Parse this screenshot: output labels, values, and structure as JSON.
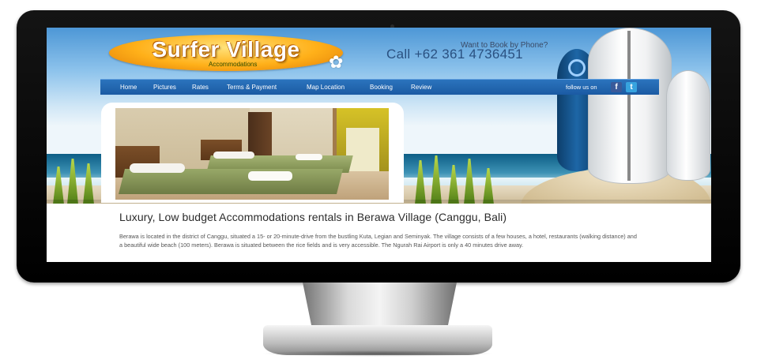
{
  "site": {
    "logo_title": "Surfer Village",
    "logo_subtitle": "Accommodations"
  },
  "header": {
    "phone_question": "Want to Book by Phone?",
    "phone_number": "Call +62 361 4736451"
  },
  "nav": {
    "items": [
      "Home",
      "Pictures",
      "Rates",
      "Terms & Payment",
      "Map Location",
      "Booking",
      "Review"
    ],
    "follow_label": "follow us on",
    "facebook_label": "f",
    "twitter_label": "t"
  },
  "main": {
    "headline": "Luxury, Low budget Accommodations rentals in Berawa Village (Canggu, Bali)",
    "body": "Berawa is located in the district of Canggu, situated a 15- or 20-minute-drive from the bustling Kuta, Legian and Seminyak. The village consists of a few houses, a hotel, restaurants (walking distance) and a beautiful wide beach (100 meters). Berawa is situated between the rice fields and is very accessible. The Ngurah Rai Airport is only a 40 minutes drive away."
  },
  "colors": {
    "nav_blue": "#1b5aa3",
    "phone_blue": "#2a5181",
    "logo_orange": "#ffb019"
  },
  "icons": {
    "flower": "plumeria-flower-icon",
    "facebook": "facebook-icon",
    "twitter": "twitter-icon"
  }
}
